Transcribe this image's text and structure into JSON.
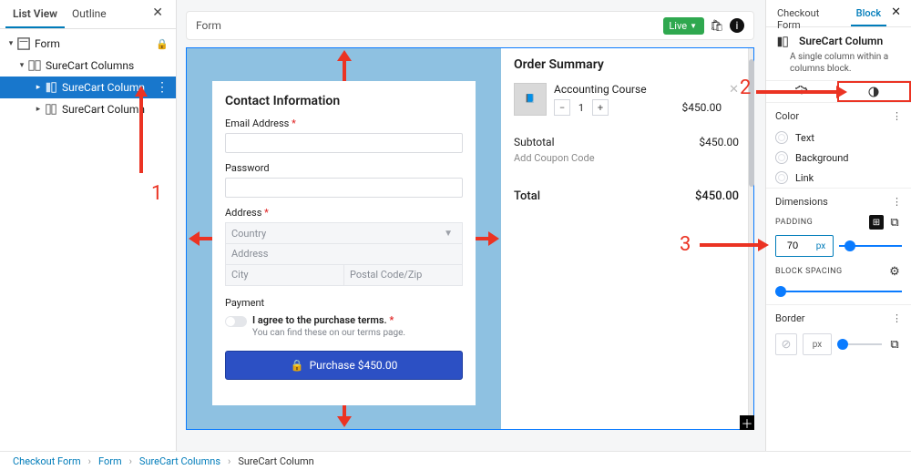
{
  "left": {
    "tab_listview": "List View",
    "tab_outline": "Outline",
    "nodes": {
      "form": "Form",
      "columns": "SureCart Columns",
      "col_sel": "SureCart Column",
      "col2": "SureCart Column"
    }
  },
  "center": {
    "bar_title": "Form",
    "live_label": "Live",
    "inner": {
      "contact_heading": "Contact Information",
      "email_label": "Email Address",
      "password_label": "Password",
      "address_label": "Address",
      "country_ph": "Country",
      "addr_ph": "Address",
      "city_ph": "City",
      "zip_ph": "Postal Code/Zip",
      "payment_label": "Payment",
      "agree_text": "I agree to the purchase terms.",
      "agree_sub": "You can find these on our terms page.",
      "buy_label": "Purchase $450.00"
    },
    "summary": {
      "heading": "Order Summary",
      "item_name": "Accounting Course",
      "qty": "1",
      "item_price": "$450.00",
      "subtotal_label": "Subtotal",
      "subtotal_val": "$450.00",
      "coupon_link": "Add Coupon Code",
      "total_label": "Total",
      "total_val": "$450.00"
    }
  },
  "right": {
    "tab_checkout": "Checkout Form",
    "tab_block": "Block",
    "title": "SureCart Column",
    "desc": "A single column within a columns block.",
    "color_heading": "Color",
    "rows": {
      "text": "Text",
      "background": "Background",
      "link": "Link"
    },
    "dim_heading": "Dimensions",
    "padding_label": "PADDING",
    "padding_value": "70",
    "padding_unit": "px",
    "block_spacing_label": "BLOCK SPACING",
    "border_heading": "Border",
    "border_unit": "px"
  },
  "annot": {
    "n1": "1",
    "n2": "2",
    "n3": "3"
  },
  "crumbs": {
    "c1": "Checkout Form",
    "c2": "Form",
    "c3": "SureCart Columns",
    "c4": "SureCart Column"
  }
}
